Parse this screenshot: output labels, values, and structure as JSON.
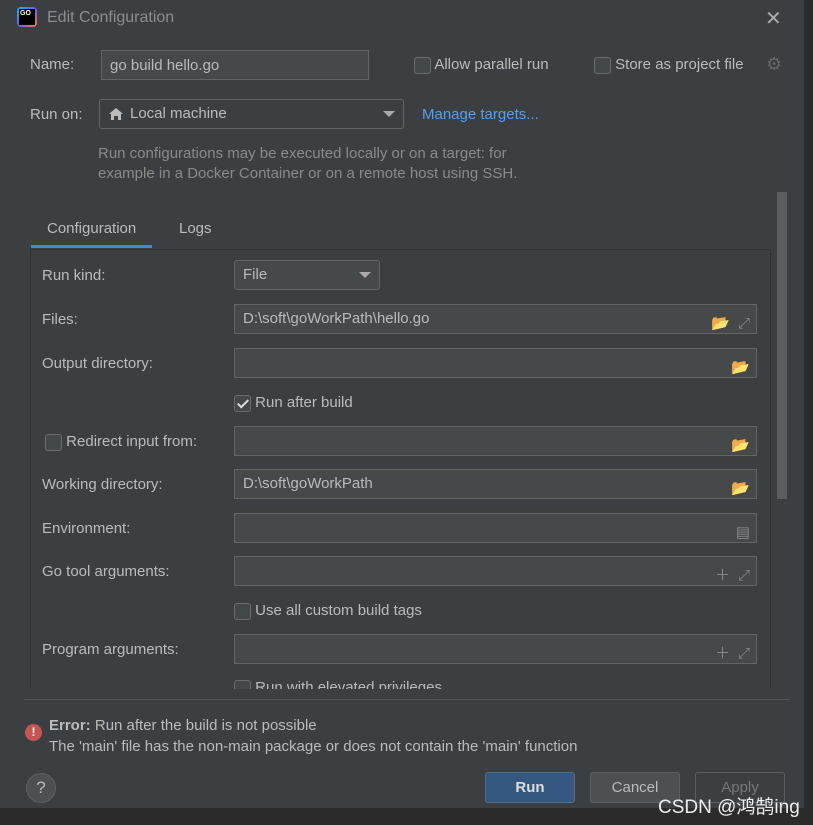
{
  "window": {
    "title": "Edit Configuration",
    "logo_text": "GO"
  },
  "name": {
    "label": "Name:",
    "value": "go build hello.go"
  },
  "options": {
    "allow_parallel": "Allow parallel run",
    "allow_parallel_checked": false,
    "store_project": "Store as project file",
    "store_project_checked": false
  },
  "run_on": {
    "label": "Run on:",
    "value": "Local machine",
    "manage": "Manage targets...",
    "hint_line1": "Run configurations may be executed locally or on a target: for",
    "hint_line2": "example in a Docker Container or on a remote host using SSH."
  },
  "tabs": [
    {
      "label": "Configuration",
      "active": true
    },
    {
      "label": "Logs",
      "active": false
    }
  ],
  "form": {
    "run_kind": {
      "label": "Run kind:",
      "value": "File"
    },
    "files": {
      "label": "Files:",
      "value": "D:\\soft\\goWorkPath\\hello.go"
    },
    "output_dir": {
      "label": "Output directory:",
      "value": ""
    },
    "run_after_build": {
      "label": "Run after build",
      "checked": true
    },
    "redirect_input": {
      "label": "Redirect input from:",
      "checked": false,
      "value": ""
    },
    "working_dir": {
      "label": "Working directory:",
      "value": "D:\\soft\\goWorkPath"
    },
    "environment": {
      "label": "Environment:",
      "value": ""
    },
    "go_tool_args": {
      "label": "Go tool arguments:",
      "value": ""
    },
    "custom_build_tags": {
      "label": "Use all custom build tags",
      "checked": false
    },
    "program_args": {
      "label": "Program arguments:",
      "value": ""
    },
    "elevated": {
      "label": "Run with elevated privileges",
      "checked": false
    }
  },
  "error": {
    "prefix": "Error:",
    "title": " Run after the build is not possible",
    "detail": "The 'main' file has the non-main package or does not contain the 'main' function",
    "color": "#c75450"
  },
  "buttons": {
    "help": "?",
    "run": "Run",
    "cancel": "Cancel",
    "apply": "Apply"
  },
  "watermark": "CSDN @鸿鹄ing",
  "colors": {
    "accent": "#4a88c7",
    "link": "#589df6",
    "primary_button": "#365880"
  }
}
